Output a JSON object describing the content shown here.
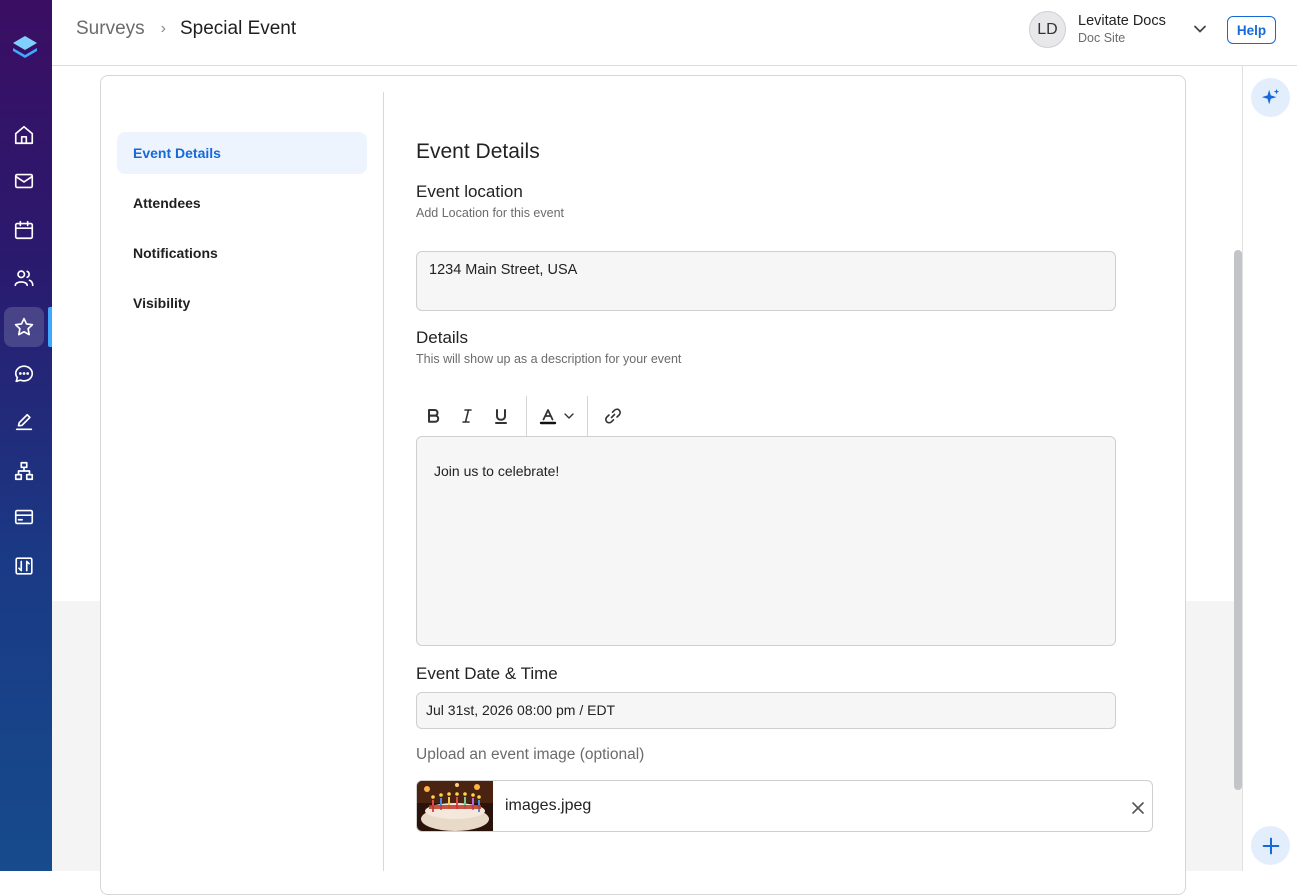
{
  "breadcrumb": {
    "parent": "Surveys",
    "separator": "›",
    "current": "Special Event"
  },
  "account": {
    "initials": "LD",
    "name": "Levitate Docs",
    "subtitle": "Doc Site"
  },
  "help_label": "Help",
  "rail_icons": [
    "home-icon",
    "mail-icon",
    "calendar-icon",
    "people-icon",
    "star-icon",
    "chat-icon",
    "edit-icon",
    "org-chart-icon",
    "card-icon",
    "sync-icon"
  ],
  "subnav": {
    "items": [
      {
        "label": "Event Details",
        "active": true
      },
      {
        "label": "Attendees"
      },
      {
        "label": "Notifications"
      },
      {
        "label": "Visibility"
      }
    ]
  },
  "form": {
    "title": "Event Details",
    "location": {
      "label": "Event location",
      "help": "Add Location for this event",
      "value": "1234 Main Street, USA"
    },
    "details": {
      "label": "Details",
      "help": "This will show up as a description for your event",
      "value": "Join us to celebrate!",
      "toolbar": [
        "bold-icon",
        "italic-icon",
        "underline-icon",
        "text-color-icon",
        "link-icon"
      ]
    },
    "datetime": {
      "label": "Event Date & Time",
      "value": "Jul 31st, 2026 08:00 pm / EDT"
    },
    "upload": {
      "label": "Upload an event image (optional)",
      "file_name": "images.jpeg"
    }
  },
  "colors": {
    "accent": "#1669d9",
    "rail_top": "#3a0e63",
    "rail_bottom": "#164b8c"
  }
}
